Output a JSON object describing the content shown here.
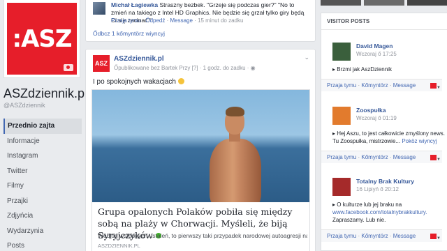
{
  "page": {
    "logo_text": ":ASZ",
    "name": "ASZdziennik.pl",
    "handle": "@ASZdziennik",
    "nav": [
      "Przednio zajta",
      "Informacje",
      "Instagram",
      "Twitter",
      "Filmy",
      "Przajki",
      "Zdjyńcia",
      "Wydarzynia",
      "Posts"
    ]
  },
  "comment": {
    "author": "Michał Łagiewka",
    "text": " Straszny bezbek. \"Grzeje się podczas gier?\" \"No to zmień na takiego z Intel HD Graphics. Nie będzie się grzał tylko giry będą Ci się zacinać.\"",
    "actions": [
      "Przaja tymu",
      "Ődpedź",
      "Message"
    ],
    "time": "15 minut do zadku",
    "more": "Ődbcz 1 kőmyntörz wiyncyj"
  },
  "post": {
    "avatar_text": "ASZ",
    "author": "ASZdziennik.pl",
    "meta": "Őpublikowane bez Bartek Przy [?] · 1 godz. do zadku · ",
    "text": "I po spokojnych wakacjach",
    "link_title": "Grupa opalonych Polaków pobiła się między sobą na plaży w Chorwacji. Myśleli, że biją Syryjczyków",
    "link_desc": "Według wstępnych ustaleń, to pierwszy taki przypadek narodowej autoagresji na",
    "link_domain": "ASZDZIENNIK.PL"
  },
  "visitor_posts": {
    "title": "VISITOR POSTS",
    "items": [
      {
        "name": "David Magen",
        "time": "Wczoraj ő 17:25",
        "line1": "Brzmi jak AszDziennik",
        "line2": "",
        "line2_link": "",
        "avatar_color": "#3a5f3c"
      },
      {
        "name": "Zoospułka",
        "time": "Wczoraj ő 01:19",
        "line1": "Hej Aszu, to jest całkowicie zmyślony news.",
        "line2": "Tu Zoospułka, mistrzowie...",
        "line2_link": "Poköz wiyncyj",
        "avatar_color": "#e27b2d"
      },
      {
        "name": "Totalny Brak Kultury",
        "time": "16 Lipiyń ő 20:12",
        "line1": "O kulturze lub jej braku na",
        "line2": "www.facebook.com/totalnybrakkultury.",
        "line2_link": "",
        "line3": "Zapraszamy. Lub nie.",
        "avatar_color": "#a52a2a"
      }
    ],
    "actions": [
      "Przaja tymu",
      "Kőmyntörz",
      "Message"
    ]
  }
}
